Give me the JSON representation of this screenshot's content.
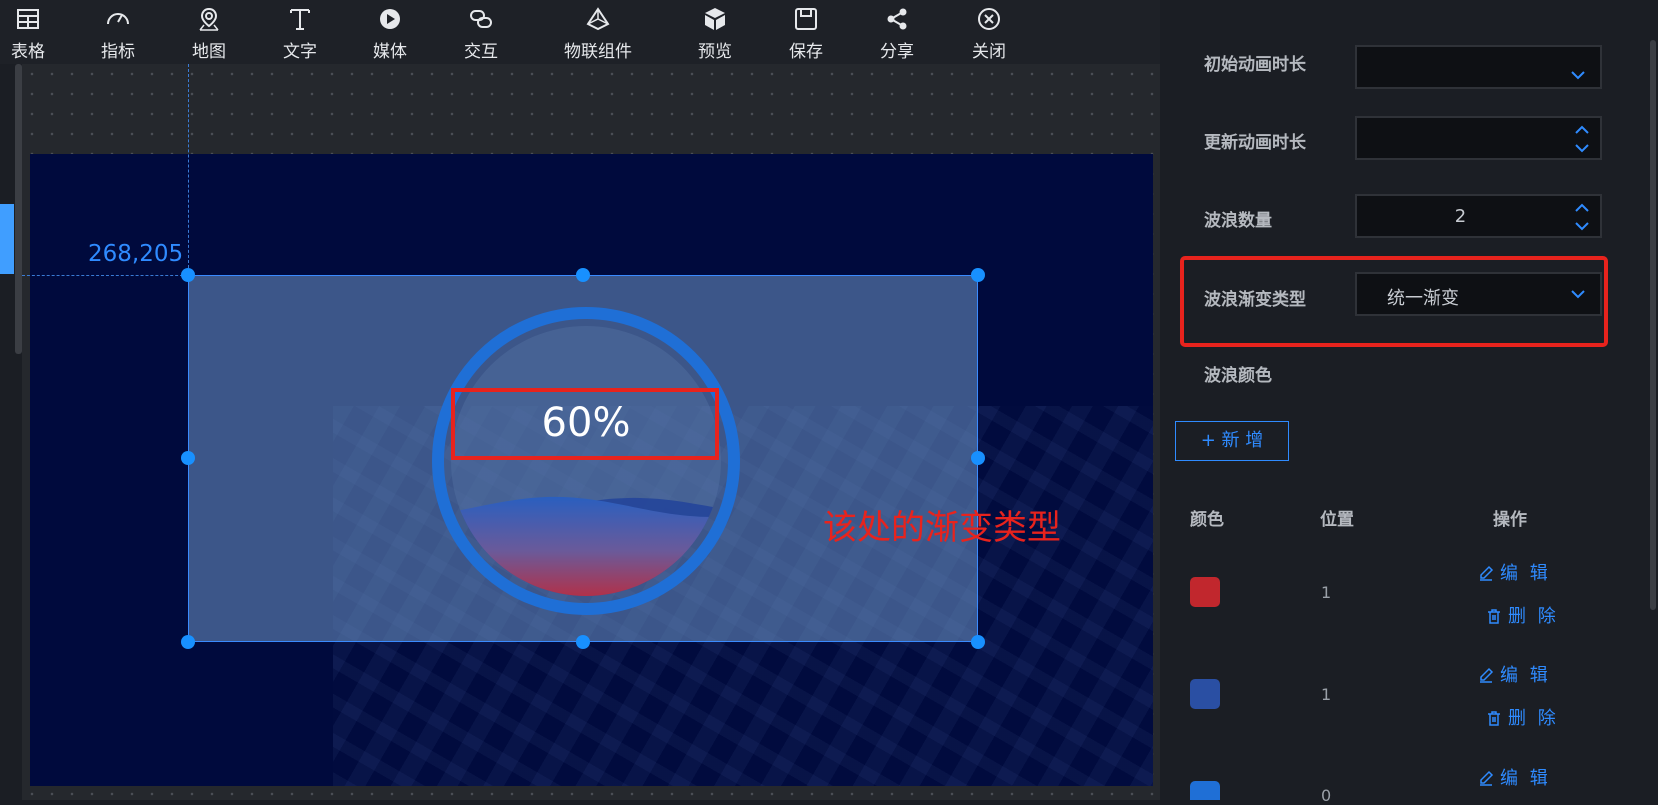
{
  "toolbar": {
    "items": [
      {
        "label": "表格",
        "icon": "table-icon"
      },
      {
        "label": "指标",
        "icon": "gauge-icon"
      },
      {
        "label": "地图",
        "icon": "map-pin-icon"
      },
      {
        "label": "文字",
        "icon": "text-icon"
      },
      {
        "label": "媒体",
        "icon": "play-icon"
      },
      {
        "label": "交互",
        "icon": "link-icon"
      },
      {
        "label": "物联组件",
        "icon": "iot-icon"
      },
      {
        "label": "预览",
        "icon": "cube-icon"
      },
      {
        "label": "保存",
        "icon": "save-icon"
      },
      {
        "label": "分享",
        "icon": "share-icon"
      },
      {
        "label": "关闭",
        "icon": "close-icon"
      }
    ]
  },
  "canvas": {
    "coord_readout": "268,205",
    "gauge_percent": "60%",
    "gauge_value": 0.6,
    "annotation": "该处的渐变类型"
  },
  "panel": {
    "rows": {
      "init_anim": {
        "label": "初始动画时长",
        "value": ""
      },
      "update_anim": {
        "label": "更新动画时长",
        "value": ""
      },
      "wave_count": {
        "label": "波浪数量",
        "value": "2"
      },
      "wave_gradient": {
        "label": "波浪渐变类型",
        "value": "统一渐变"
      },
      "wave_color": {
        "label": "波浪颜色"
      }
    },
    "add_button": "+ 新 增",
    "table": {
      "headers": [
        "颜色",
        "位置",
        "操作"
      ],
      "rows": [
        {
          "color": "#c1272d",
          "position": "1",
          "edit": "编 辑",
          "delete": "删 除"
        },
        {
          "color": "#2a4fa3",
          "position": "1",
          "edit": "编 辑",
          "delete": "删 除"
        },
        {
          "color": "#1f6fd6",
          "position": "0",
          "edit": "编 辑",
          "delete": ""
        }
      ]
    }
  },
  "colors": {
    "accent": "#2f8bff",
    "highlight": "#e8231d"
  }
}
